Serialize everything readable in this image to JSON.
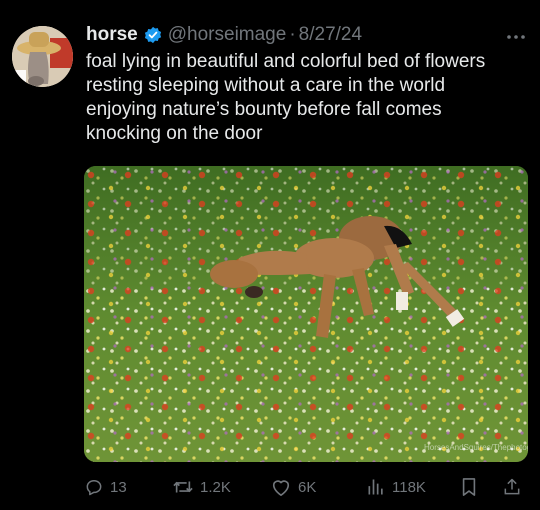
{
  "post": {
    "author_name": "horse",
    "handle": "@horseimage",
    "separator": "·",
    "date": "8/27/24",
    "text_lines": [
      "foal lying in beautiful and colorful bed of flowers",
      "resting sleeping without a care in the world",
      "enjoying nature’s bounty before fall comes",
      "knocking on the door"
    ],
    "image_watermark": "HorsesAndSquires/Thephotographer"
  },
  "actions": {
    "replies": "13",
    "reposts": "1.2K",
    "likes": "6K",
    "views": "118K"
  },
  "colors": {
    "background": "#000000",
    "text": "#e7e9ea",
    "muted": "#71767b",
    "verified": "#1d9bf0"
  },
  "icons": [
    "verified-badge-icon",
    "more-icon",
    "reply-icon",
    "repost-icon",
    "like-icon",
    "views-icon",
    "bookmark-icon",
    "share-icon"
  ]
}
